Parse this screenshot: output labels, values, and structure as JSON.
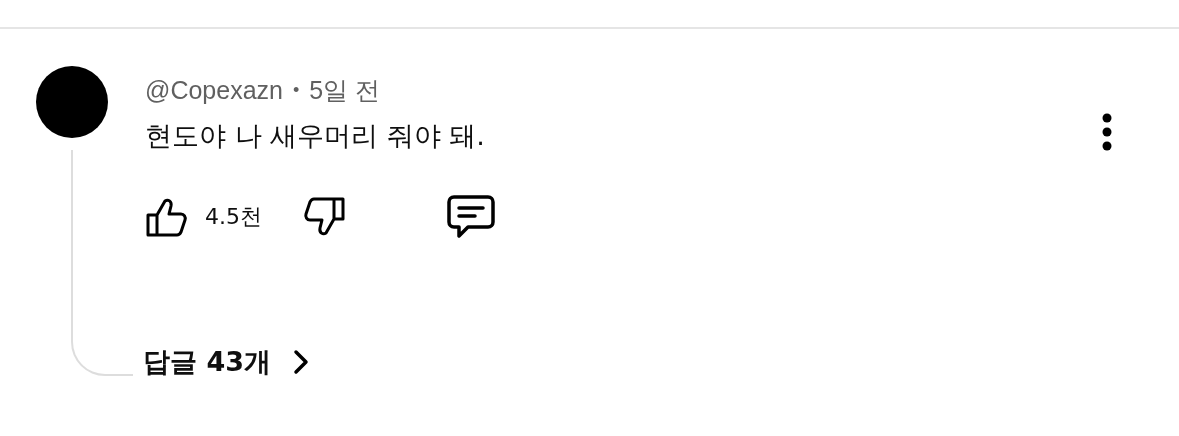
{
  "comment": {
    "author": "@Copexazn",
    "separator": "•",
    "time": "5일 전",
    "text": "현도야 나 새우머리 줘야 돼.",
    "likes": "4.5천",
    "replies": "답글 43개"
  }
}
